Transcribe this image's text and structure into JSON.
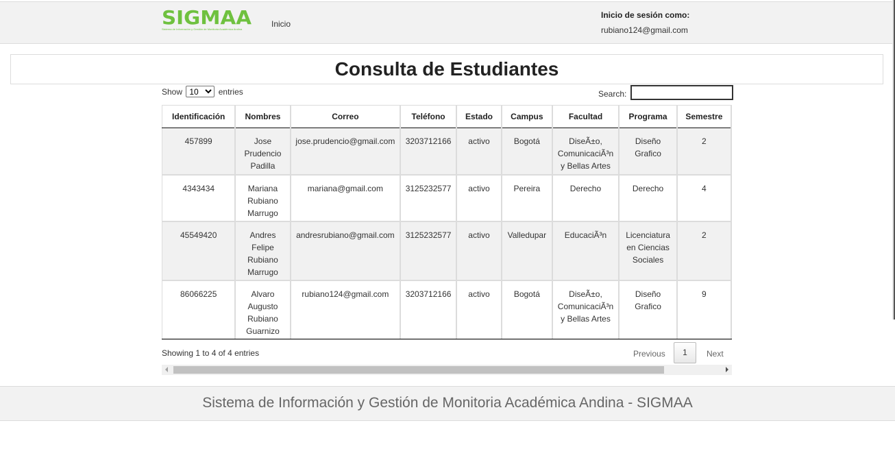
{
  "header": {
    "logo_text": "SIGMAA",
    "logo_tagline": "Sistema de Información y Gestión de Monitoria Académica Andina",
    "nav_home": "Inicio",
    "session_label": "Inicio de sesión como:",
    "session_email": "rubiano124@gmail.com"
  },
  "page": {
    "title": "Consulta de Estudiantes"
  },
  "controls": {
    "show_label": "Show",
    "entries_label": "entries",
    "page_length": "10",
    "search_label": "Search:",
    "search_value": ""
  },
  "table": {
    "headers": [
      "Identificación",
      "Nombres",
      "Correo",
      "Teléfono",
      "Estado",
      "Campus",
      "Facultad",
      "Programa",
      "Semestre"
    ],
    "rows": [
      [
        "457899",
        "Jose Prudencio Padilla",
        "jose.prudencio@gmail.com",
        "3203712166",
        "activo",
        "Bogotá",
        "DiseÃ±o, ComunicaciÃ³n y Bellas Artes",
        "Diseño Grafico",
        "2"
      ],
      [
        "4343434",
        "Mariana Rubiano Marrugo",
        "mariana@gmail.com",
        "3125232577",
        "activo",
        "Pereira",
        "Derecho",
        "Derecho",
        "4"
      ],
      [
        "45549420",
        "Andres Felipe Rubiano Marrugo",
        "andresrubiano@gmail.com",
        "3125232577",
        "activo",
        "Valledupar",
        "EducaciÃ³n",
        "Licenciatura en Ciencias Sociales",
        "2"
      ],
      [
        "86066225",
        "Alvaro Augusto Rubiano Guarnizo",
        "rubiano124@gmail.com",
        "3203712166",
        "activo",
        "Bogotá",
        "DiseÃ±o, ComunicaciÃ³n y Bellas Artes",
        "Diseño Grafico",
        "9"
      ]
    ]
  },
  "pagination": {
    "info": "Showing 1 to 4 of 4 entries",
    "previous": "Previous",
    "current_page": "1",
    "next": "Next"
  },
  "footer": {
    "text": "Sistema de Información y Gestión de Monitoria Académica Andina - SIGMAA"
  }
}
